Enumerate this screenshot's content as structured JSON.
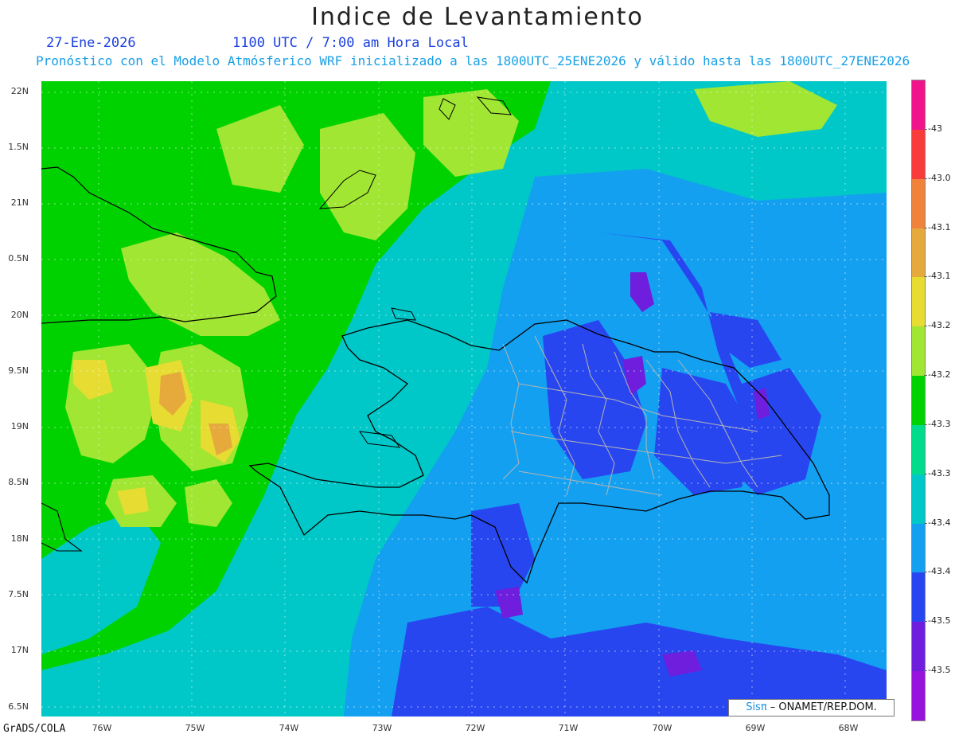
{
  "header": {
    "title": "Indice de Levantamiento",
    "date": "27-Ene-2026",
    "time": "1100 UTC / 7:00 am Hora Local",
    "description": "Pronóstico con el Modelo Atmósferico WRF inicializado a las 1800UTC_25ENE2026 y válido hasta las  1800UTC_27ENE2026"
  },
  "map": {
    "lat_labels": [
      "22N",
      "1.5N",
      "21N",
      "0.5N",
      "20N",
      "9.5N",
      "19N",
      "8.5N",
      "18N",
      "7.5N",
      "17N",
      "6.5N"
    ],
    "lon_labels": [
      "76W",
      "75W",
      "74W",
      "73W",
      "72W",
      "71W",
      "70W",
      "69W",
      "68W"
    ],
    "credit": "GrADS/COLA",
    "stamp_brand": "Sisπ",
    "stamp_text": " – ONAMET/REP.DOM."
  },
  "colorbar": {
    "labels": [
      "-43",
      "-43.0",
      "-43.1",
      "-43.1",
      "-43.2",
      "-43.2",
      "-43.3",
      "-43.3",
      "-43.4",
      "-43.4",
      "-43.5",
      "-43.5"
    ],
    "colors": [
      "#f0148c",
      "#f83c3c",
      "#f0823c",
      "#e6aa3c",
      "#e6dc32",
      "#a0e632",
      "#00d200",
      "#00dc8c",
      "#00c8c8",
      "#14a0f0",
      "#2846f0",
      "#6e1edc",
      "#9614dc"
    ]
  }
}
